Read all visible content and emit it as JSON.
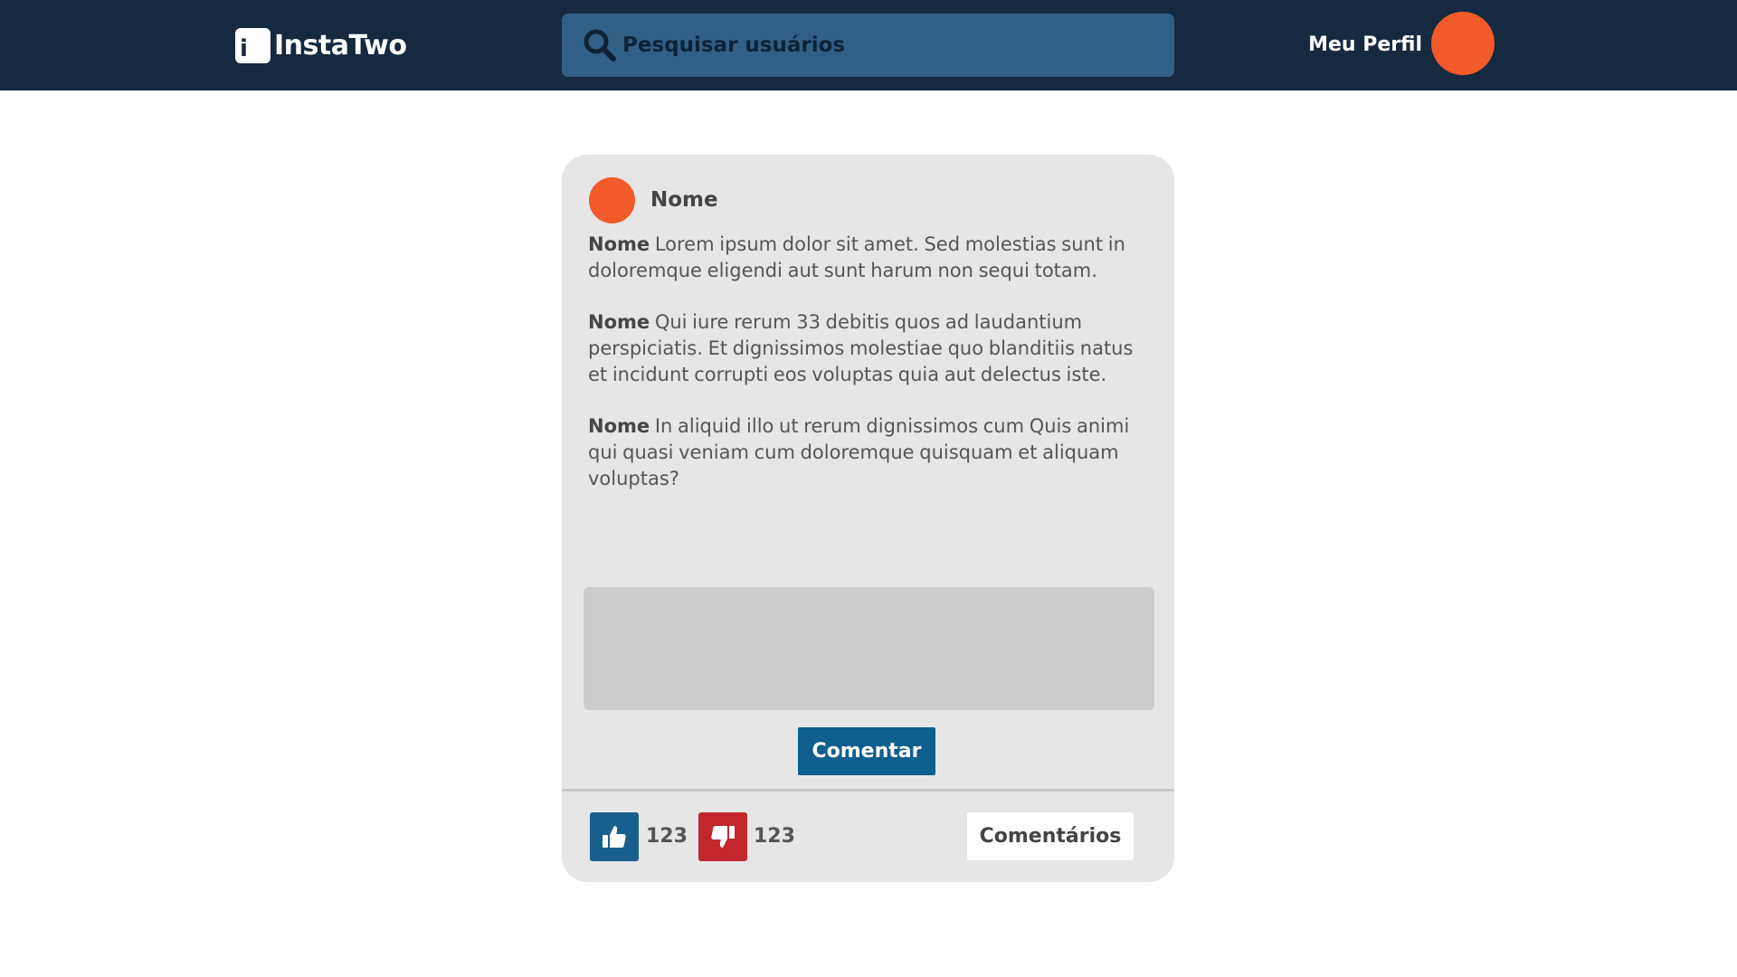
{
  "header": {
    "logo_letter": "i",
    "logo_text": "InstaTwo",
    "search_placeholder": "Pesquisar usuários",
    "profile_label": "Meu Perfil"
  },
  "post": {
    "author_name": "Nome",
    "comments": [
      {
        "author": "Nome",
        "text": "Lorem ipsum dolor sit amet. Sed molestias sunt in doloremque eligendi aut sunt harum non sequi totam."
      },
      {
        "author": "Nome",
        "text": "Qui iure rerum 33 debitis quos ad laudantium perspiciatis. Et dignissimos molestiae quo blanditiis natus et incidunt corrupti eos voluptas quia aut delectus iste."
      },
      {
        "author": "Nome",
        "text": "In aliquid illo ut rerum dignissimos cum Quis animi qui quasi veniam cum doloremque quisquam et aliquam voluptas?"
      }
    ],
    "comment_input_value": "",
    "submit_label": "Comentar",
    "likes": "123",
    "dislikes": "123",
    "comments_button_label": "Comentários"
  },
  "icons": {
    "search": "search-icon",
    "like": "thumbs-up-icon",
    "dislike": "thumbs-down-icon"
  },
  "colors": {
    "header_bg": "#152940",
    "search_bg": "#325f86",
    "accent_orange": "#f15a29",
    "card_bg": "#e6e6e6",
    "like_blue": "#195f8e",
    "dislike_red": "#c1272d",
    "button_blue": "#0e5f8e"
  }
}
